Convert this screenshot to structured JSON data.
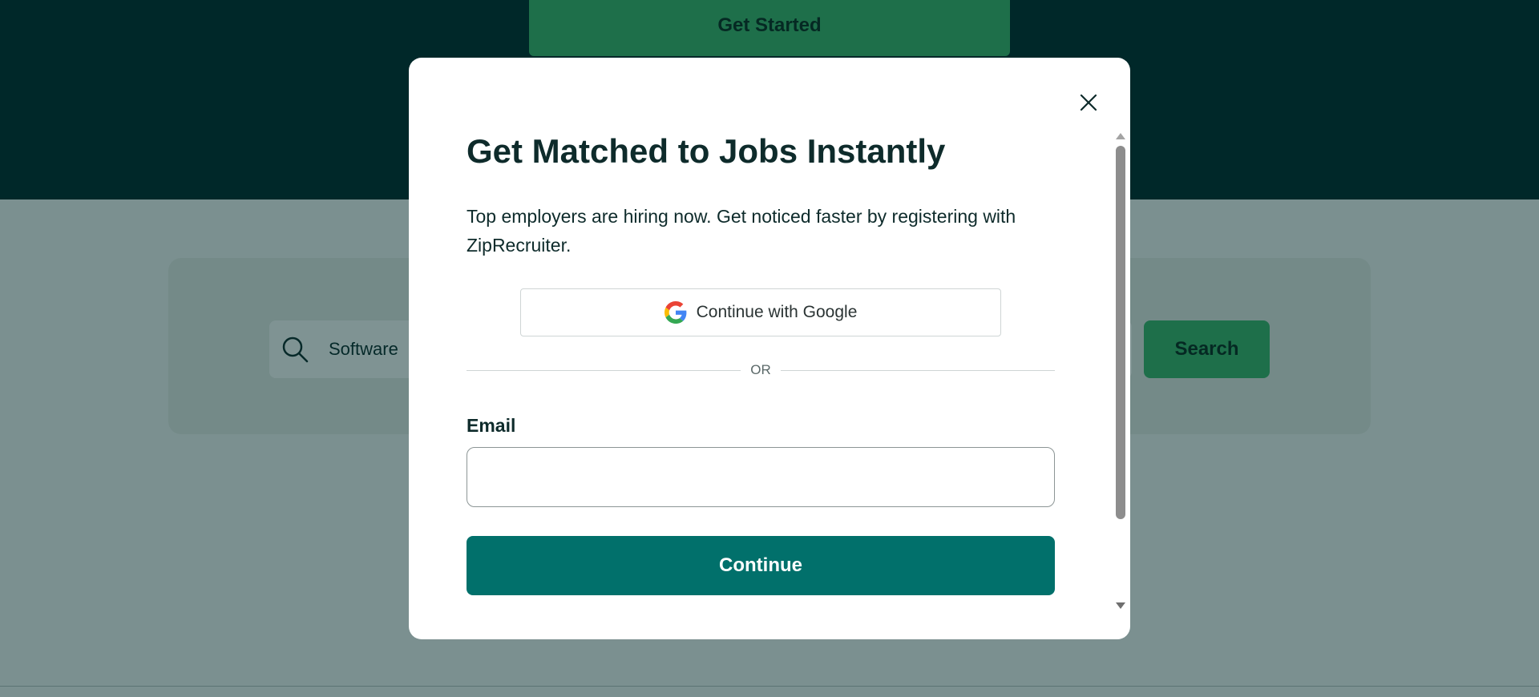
{
  "background": {
    "hero_cta_label": "Get Started",
    "search_value": "Software",
    "search_button_label": "Search"
  },
  "modal": {
    "title": "Get Matched to Jobs Instantly",
    "description": "Top employers are hiring now. Get noticed faster by registering with ZipRecruiter.",
    "google_button_label": "Continue with Google",
    "divider_text": "OR",
    "email_label": "Email",
    "email_value": "",
    "continue_label": "Continue",
    "close_icon": "close-icon",
    "google_icon": "google-g-icon"
  },
  "colors": {
    "hero_band": "#00292b",
    "brand_green": "#3db66c",
    "primary_teal": "#01706b",
    "overlay": "rgba(0,40,40,0.5)"
  }
}
